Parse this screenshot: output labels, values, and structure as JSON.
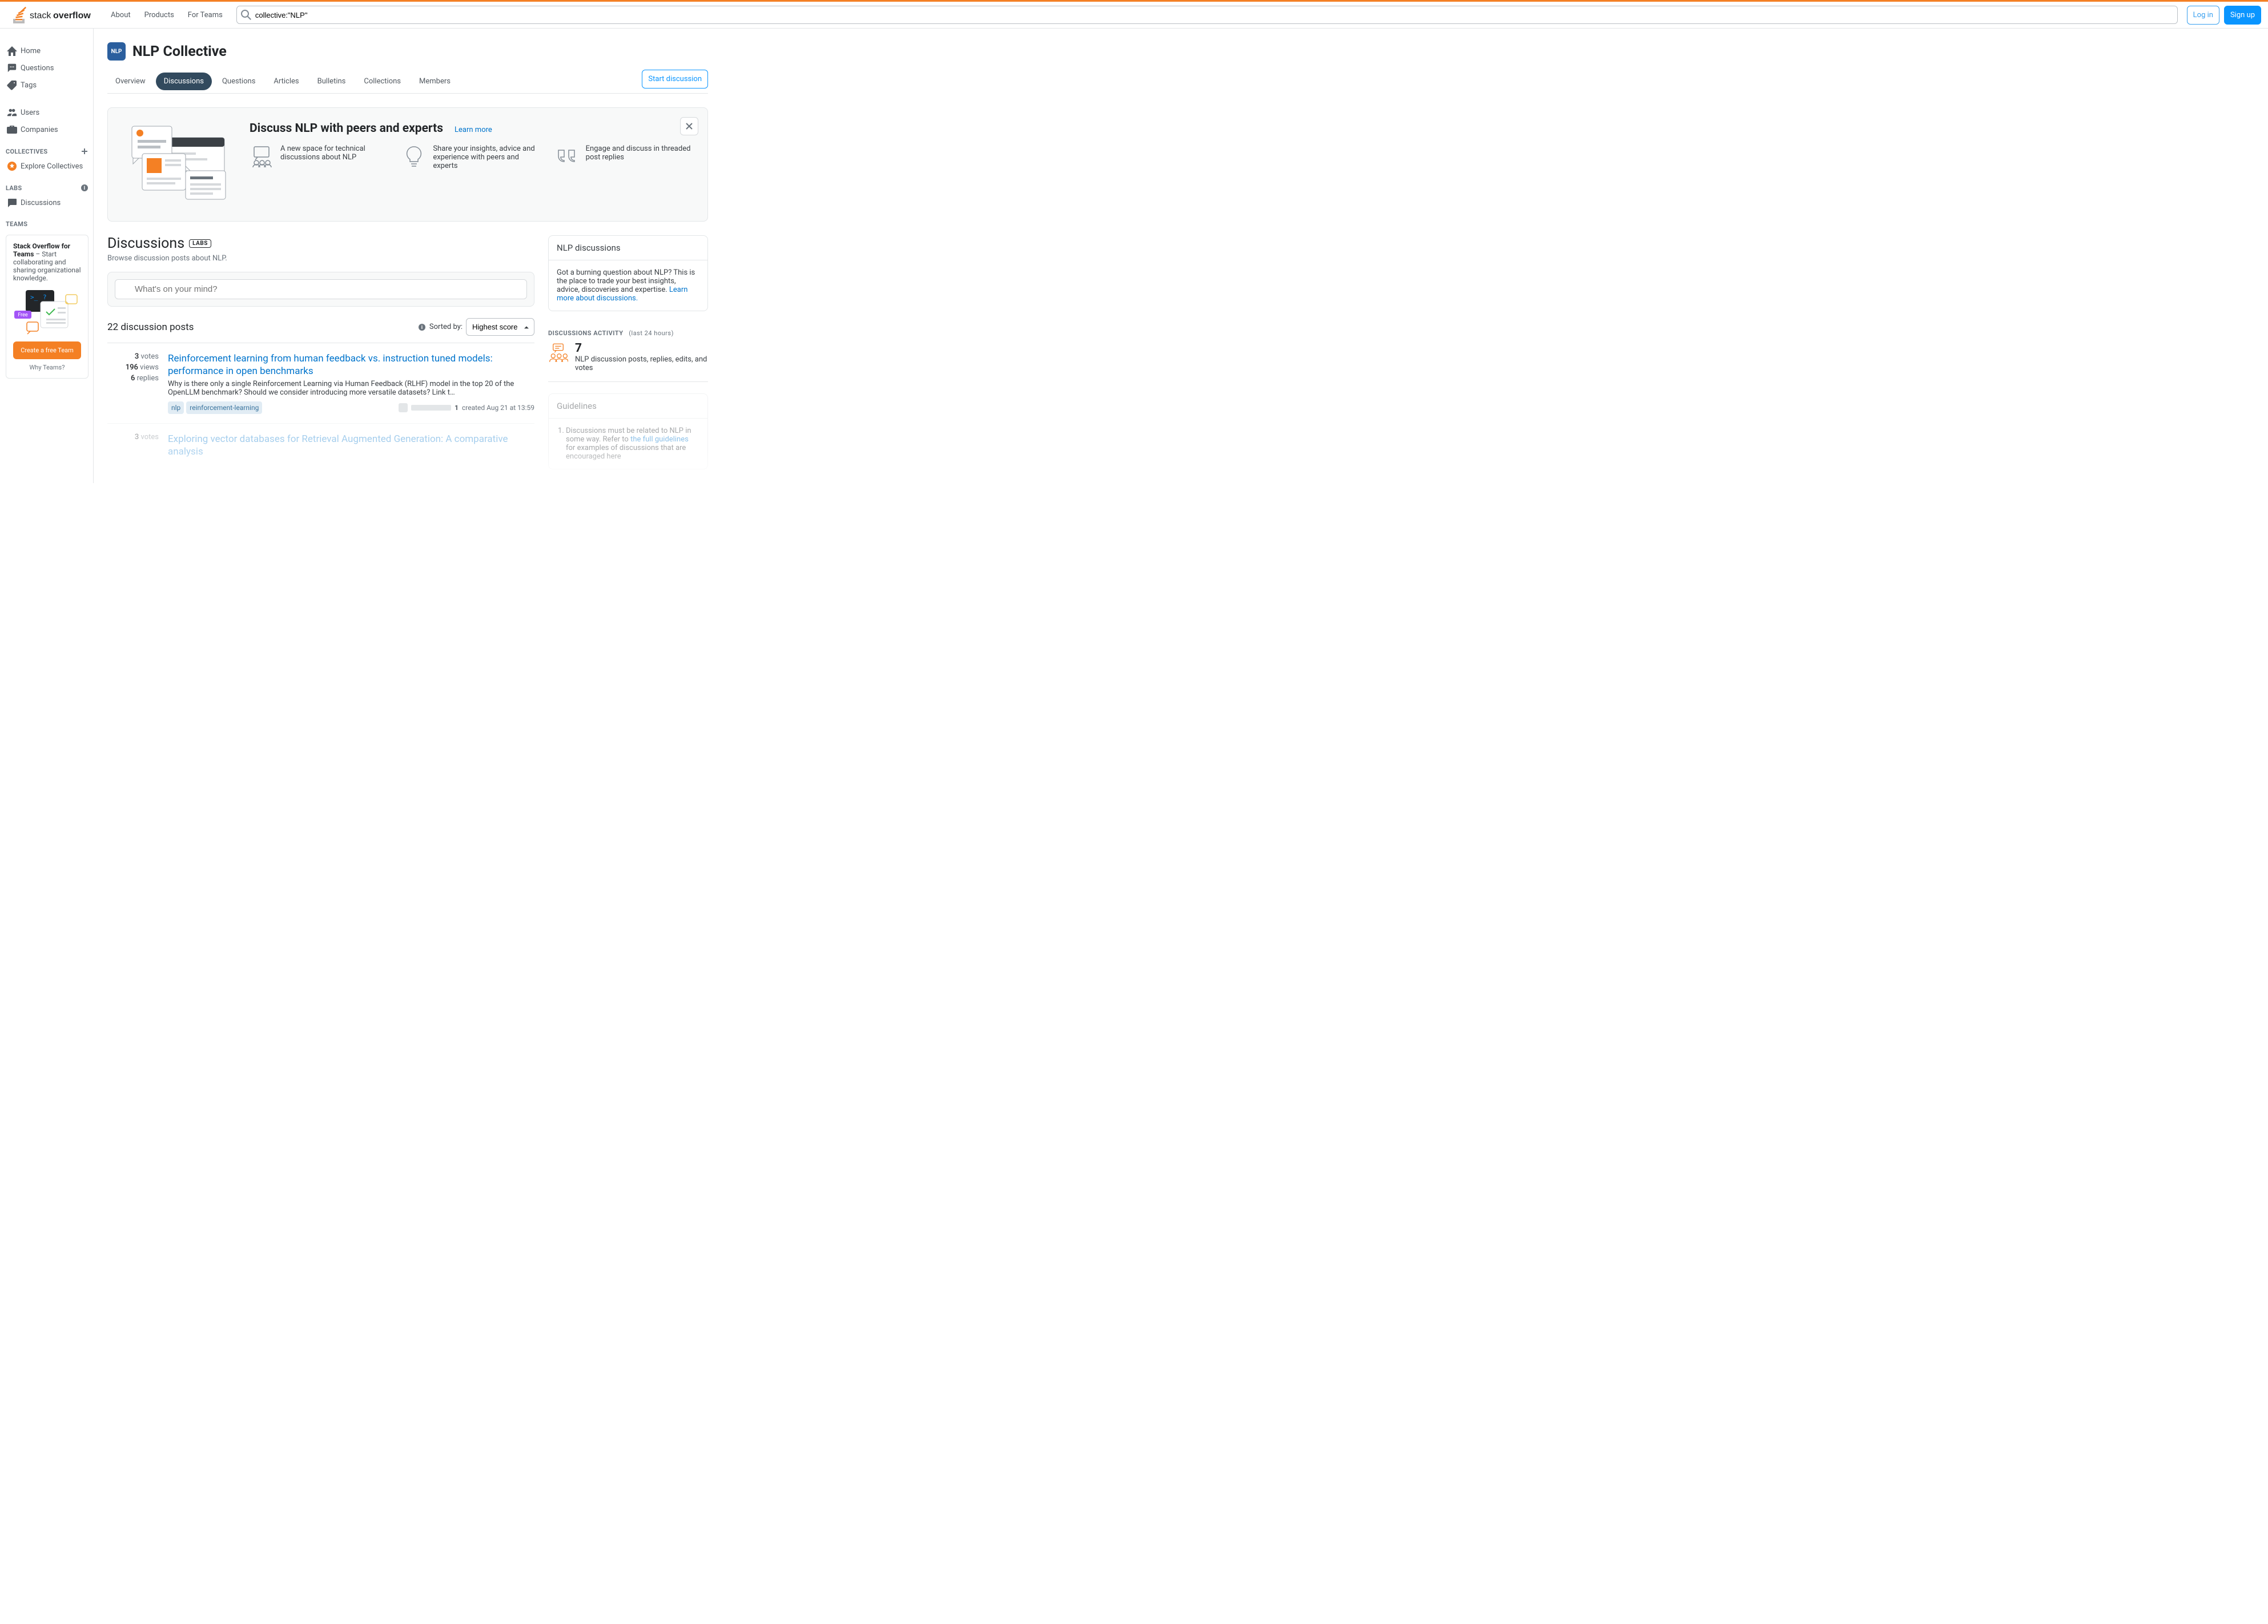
{
  "topnav": {
    "items": [
      "About",
      "Products",
      "For Teams"
    ],
    "search_value": "collective:\"NLP\"",
    "login": "Log in",
    "signup": "Sign up"
  },
  "leftnav": {
    "home": "Home",
    "questions": "Questions",
    "tags": "Tags",
    "users": "Users",
    "companies": "Companies",
    "collectives_heading": "Collectives",
    "explore": "Explore Collectives",
    "labs_heading": "Labs",
    "discussions": "Discussions",
    "teams_heading": "Teams"
  },
  "teams_card": {
    "bold": "Stack Overflow for Teams",
    "rest": " – Start collaborating and sharing organizational knowledge.",
    "free_badge": "Free",
    "cta": "Create a free Team",
    "why": "Why Teams?"
  },
  "page": {
    "badge": "NLP",
    "title": "NLP Collective",
    "tabs": [
      "Overview",
      "Discussions",
      "Questions",
      "Articles",
      "Bulletins",
      "Collections",
      "Members"
    ],
    "active_tab": 1,
    "start_button": "Start discussion"
  },
  "banner": {
    "title": "Discuss NLP with peers and experts",
    "learn_more": "Learn more",
    "features": [
      "A new space for technical discussions about NLP",
      "Share your insights, advice and experience with peers and experts",
      "Engage and discuss in threaded post replies"
    ]
  },
  "discussions": {
    "heading": "Discussions",
    "labs": "LABS",
    "sub": "Browse discussion posts about NLP.",
    "compose_placeholder": "What's on your mind?",
    "count": "22 discussion posts",
    "sorted_by": "Sorted by:",
    "sort_value": "Highest score"
  },
  "posts": [
    {
      "votes": "3",
      "votes_label": "votes",
      "views": "196",
      "views_label": "views",
      "replies": "6",
      "replies_label": "replies",
      "title": "Reinforcement learning from human feedback vs. instruction tuned models: performance in open benchmarks",
      "excerpt": "Why is there only a single Reinforcement Learning via Human Feedback (RLHF) model in the top 20 of the OpenLLM benchmark? Should we consider introducing more versatile datasets? Link t…",
      "tags": [
        "nlp",
        "reinforcement-learning"
      ],
      "rep": "1",
      "meta": "created Aug 21 at 13:59"
    },
    {
      "votes": "3",
      "votes_label": "votes",
      "views": "",
      "views_label": "",
      "replies": "",
      "replies_label": "",
      "title": "Exploring vector databases for Retrieval Augmented Generation: A comparative analysis",
      "excerpt": "",
      "tags": [],
      "rep": "",
      "meta": ""
    }
  ],
  "side": {
    "card1_header": "NLP discussions",
    "card1_body_pre": "Got a burning question about NLP? This is the place to trade your best insights, advice, discoveries and expertise. ",
    "card1_link": "Learn more about discussions.",
    "activity_heading": "Discussions Activity",
    "activity_sub": "(last 24 hours)",
    "activity_num": "7",
    "activity_desc": "NLP discussion posts, replies, edits, and votes",
    "guidelines_header": "Guidelines",
    "guideline_pre": "Discussions must be related to NLP in some way. Refer to ",
    "guideline_link": "the full guidelines",
    "guideline_post": " for examples of discussions that are encouraged here"
  }
}
